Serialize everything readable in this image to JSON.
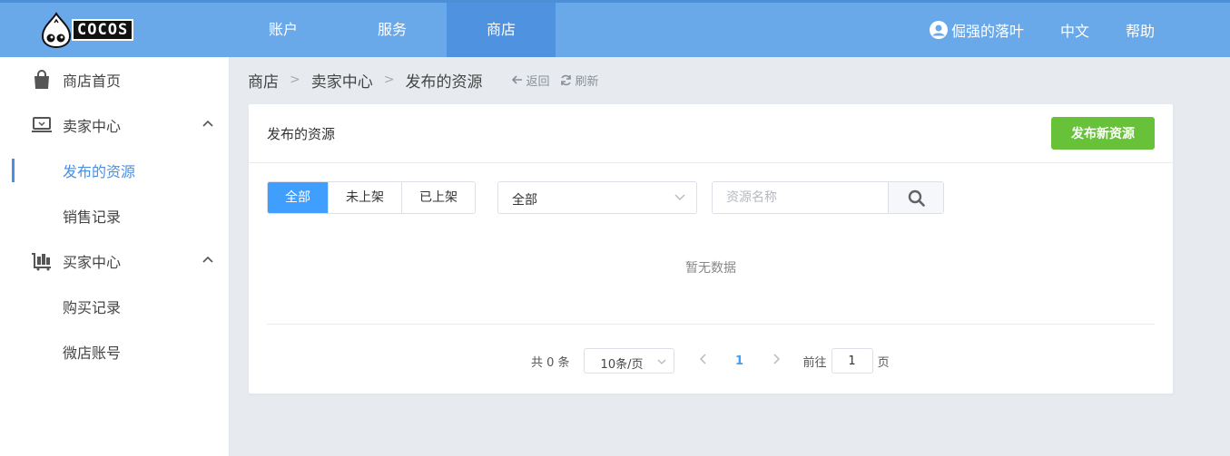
{
  "header": {
    "logo_text": "COCOS",
    "nav": [
      {
        "label": "账户"
      },
      {
        "label": "服务"
      },
      {
        "label": "商店"
      }
    ],
    "user_name": "倔强的落叶",
    "language": "中文",
    "help": "帮助"
  },
  "sidebar": {
    "items": [
      {
        "label": "商店首页"
      },
      {
        "label": "卖家中心"
      },
      {
        "label": "发布的资源"
      },
      {
        "label": "销售记录"
      },
      {
        "label": "买家中心"
      },
      {
        "label": "购买记录"
      },
      {
        "label": "微店账号"
      }
    ]
  },
  "breadcrumb": {
    "items": [
      "商店",
      "卖家中心",
      "发布的资源"
    ],
    "back": "返回",
    "refresh": "刷新"
  },
  "card": {
    "title": "发布的资源",
    "publish_button": "发布新资源",
    "filters": [
      "全部",
      "未上架",
      "已上架"
    ],
    "select_value": "全部",
    "search_placeholder": "资源名称",
    "empty_text": "暂无数据"
  },
  "pagination": {
    "total": "共 0 条",
    "page_size": "10条/页",
    "current_page": "1",
    "goto_label": "前往",
    "goto_value": "1",
    "page_unit": "页"
  },
  "colors": {
    "header": "#6aa9e9",
    "header_active": "#4f93e0",
    "primary": "#409eff",
    "success": "#67c23a"
  }
}
